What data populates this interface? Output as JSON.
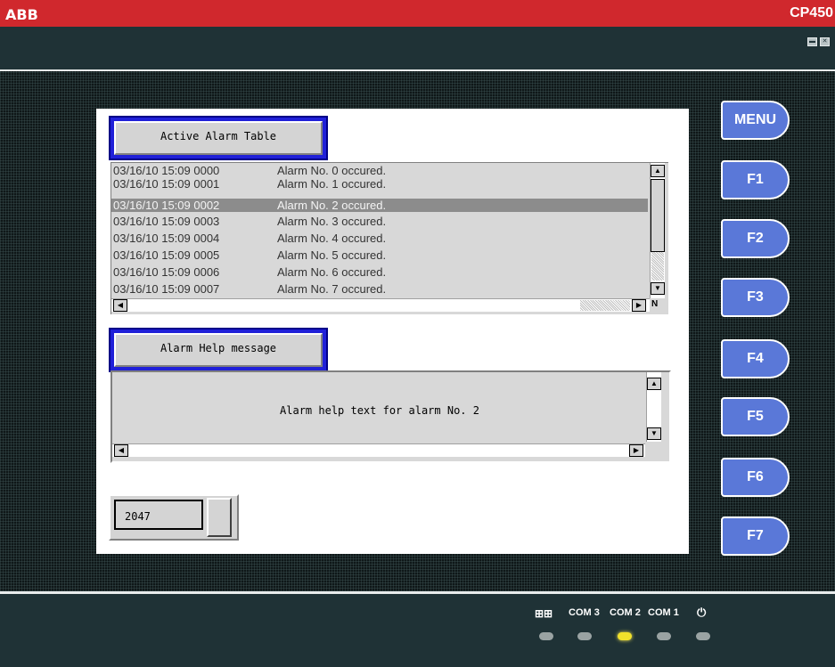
{
  "header": {
    "brand": "ABB",
    "model": "CP450",
    "window_controls": [
      "minimize-icon",
      "close-icon"
    ]
  },
  "alarm_table": {
    "title": "Active Alarm Table",
    "rows": [
      {
        "timestamp": "03/16/10 15:09 0000",
        "message": "Alarm No. 0 occured."
      },
      {
        "timestamp": "03/16/10 15:09 0001",
        "message": "Alarm No. 1 occured."
      },
      {
        "timestamp": "03/16/10 15:09 0002",
        "message": "Alarm No. 2 occured."
      },
      {
        "timestamp": "03/16/10 15:09 0003",
        "message": "Alarm No. 3 occured."
      },
      {
        "timestamp": "03/16/10 15:09 0004",
        "message": "Alarm No. 4 occured."
      },
      {
        "timestamp": "03/16/10 15:09 0005",
        "message": "Alarm No. 5 occured."
      },
      {
        "timestamp": "03/16/10 15:09 0006",
        "message": "Alarm No. 6 occured."
      },
      {
        "timestamp": "03/16/10 15:09 0007",
        "message": "Alarm No. 7 occured."
      }
    ],
    "selected_index": 2,
    "corner_label": "N"
  },
  "help": {
    "title": "Alarm Help message",
    "text": "Alarm help text for alarm No. 2"
  },
  "numeric_field": {
    "value": "2047"
  },
  "function_keys": [
    "MENU",
    "F1",
    "F2",
    "F3",
    "F4",
    "F5",
    "F6",
    "F7"
  ],
  "status_bar": {
    "ports": [
      {
        "label": "",
        "icon": "network-icon",
        "state": "off"
      },
      {
        "label": "COM 3",
        "state": "off"
      },
      {
        "label": "COM 2",
        "state": "on"
      },
      {
        "label": "COM 1",
        "state": "off"
      },
      {
        "label": "",
        "icon": "power-icon",
        "state": "off"
      }
    ]
  },
  "colors": {
    "brand_red": "#d0282d",
    "bezel": "#1f3236",
    "fkey_blue": "#5a78d8",
    "title_border_blue": "#2020d8",
    "selection_gray": "#8c8c8c",
    "led_active": "#f2e22b"
  }
}
